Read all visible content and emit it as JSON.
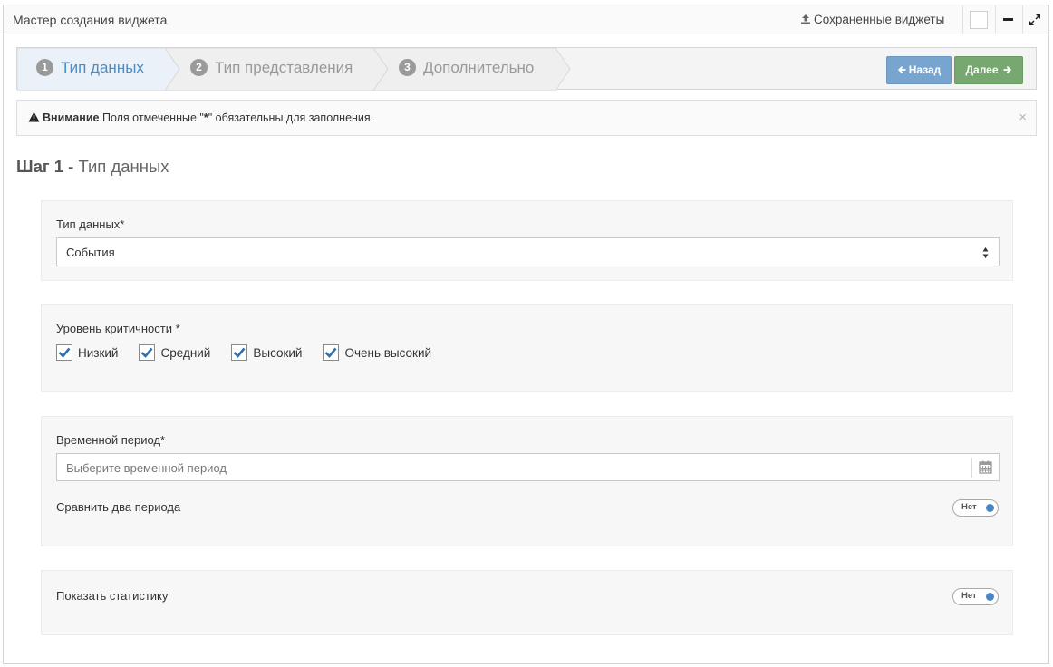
{
  "window": {
    "title": "Мастер создания виджета",
    "saved_widgets_label": "Сохраненные виджеты",
    "upload_icon": "upload-icon",
    "minimize_icon": "minus-icon",
    "expand_icon": "expand-icon"
  },
  "wizard": {
    "steps": [
      {
        "num": "1",
        "label": "Тип данных",
        "active": true
      },
      {
        "num": "2",
        "label": "Тип представления",
        "active": false
      },
      {
        "num": "3",
        "label": "Дополнительно",
        "active": false
      }
    ],
    "back_label": "Назад",
    "next_label": "Далее",
    "back_color": "#78a5cf",
    "next_color": "#76a86f"
  },
  "alert": {
    "title": "Внимание",
    "text_before": "Поля отмеченные \"",
    "star": "*",
    "text_after": "\" обязательны для заполнения.",
    "close": "×"
  },
  "heading": {
    "step": "Шаг 1 -",
    "title": "Тип данных"
  },
  "data_type": {
    "label": "Тип данных*",
    "value": "События"
  },
  "severity": {
    "label": "Уровень критичности *",
    "options": [
      {
        "label": "Низкий",
        "checked": true
      },
      {
        "label": "Средний",
        "checked": true
      },
      {
        "label": "Высокий",
        "checked": true
      },
      {
        "label": "Очень высокий",
        "checked": true
      }
    ]
  },
  "period": {
    "label": "Временной период*",
    "placeholder": "Выберите временной период",
    "compare_label": "Сравнить два периода",
    "compare_toggle": "Нет"
  },
  "stats": {
    "label": "Показать статистику",
    "toggle": "Нет"
  },
  "colors": {
    "accent": "#4e8bc4",
    "checkbox_check": "#2f6fae"
  }
}
